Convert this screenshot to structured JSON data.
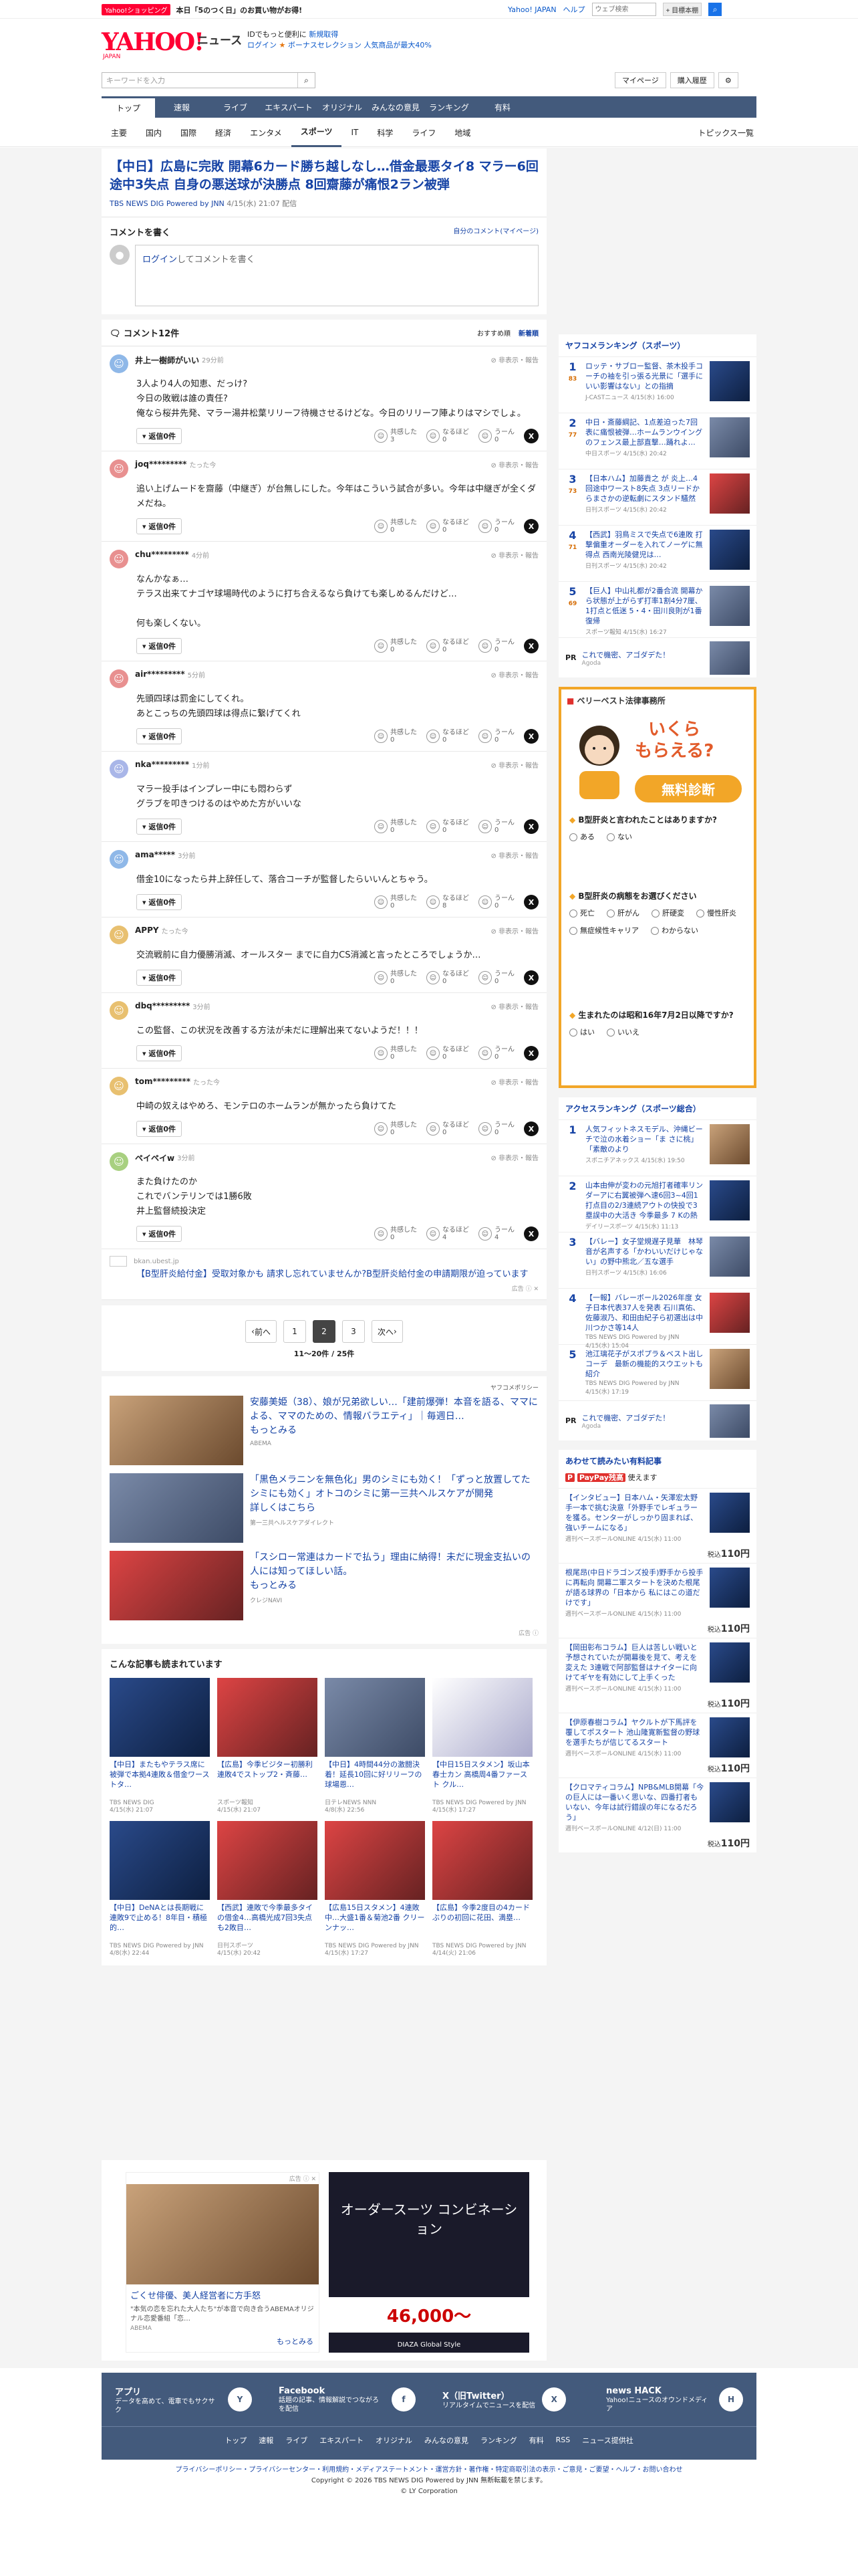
{
  "promo": {
    "tag": "Yahoo!ショッピング",
    "text": "本日「5のつく日」のお買い物がお得!",
    "links": [
      "Yahoo! JAPAN",
      "ヘルプ"
    ],
    "search_placeholder": "ウェブ検索",
    "search_button": "検索",
    "mark_button": "+ 目標本棚"
  },
  "header": {
    "logo": "YAHOO!",
    "logo_sub": "JAPAN",
    "title": "ニュース",
    "line1a": "IDでもっと便利に",
    "line1b": "新規取得",
    "line2a": "ログイン",
    "line2b": "ボーナスセレクション",
    "line2c": "人気商品が最大40%"
  },
  "search": {
    "placeholder": "キーワードを入力",
    "mypage": "マイページ",
    "history": "購入履歴"
  },
  "nav": {
    "tabs": [
      "トップ",
      "速報",
      "ライブ",
      "エキスパート",
      "オリジナル",
      "みんなの意見",
      "ランキング",
      "有料"
    ],
    "sub": [
      "主要",
      "国内",
      "国際",
      "経済",
      "エンタメ",
      "スポーツ",
      "IT",
      "科学",
      "ライフ",
      "地域"
    ],
    "topics": "トピックス一覧"
  },
  "article": {
    "title": "【中日】広島に完敗 開幕6カード勝ち越しなし…借金最悪タイ8 マラー6回途中3失点 自身の悪送球が決勝点 8回齋藤が痛恨2ラン被弾",
    "source": "TBS NEWS DIG Powered by JNN",
    "date": "4/15(水) 21:07 配信"
  },
  "comment_form": {
    "title": "コメントを書く",
    "mine": "自分のコメント(マイページ)",
    "login": "ログイン",
    "placeholder": "してコメントを書く"
  },
  "comments_header": {
    "title": "コメント12件",
    "sort1": "おすすめ順",
    "sort2": "新着順"
  },
  "labels": {
    "report": "非表示・報告",
    "reply": "返信0件",
    "r1": "共感した",
    "r2": "なるほど",
    "r3": "うーん"
  },
  "comments": [
    {
      "user": "井上一樹師がいい",
      "time": "29分前",
      "text": "3人より4人の知恵、だっけ?\n今日の敗戦は誰の責任?\n俺なら桜井先発、マラー湯井松葉リリーフ待機させるけどな。今日のリリーフ陣よりはマシでしょ。",
      "c1": "3",
      "c2": "0",
      "c3": "0",
      "color": "#8fb8e8"
    },
    {
      "user": "joq*********",
      "time": "たった今",
      "text": "追い上げムードを齋藤（中継ぎ）が台無しにした。今年はこういう試合が多い。今年は中継ぎが全くダメだね。",
      "c1": "0",
      "c2": "0",
      "c3": "0",
      "color": "#e89090"
    },
    {
      "user": "chu*********",
      "time": "4分前",
      "text": "なんかなぁ…\nテラス出来てナゴヤ球場時代のように打ち合えるなら負けても楽しめるんだけど…\n\n何も楽しくない。",
      "c1": "0",
      "c2": "0",
      "c3": "0",
      "color": "#e89090"
    },
    {
      "user": "air*********",
      "time": "5分前",
      "text": "先頭四球は罰金にしてくれ。\nあとこっちの先頭四球は得点に繋げてくれ",
      "c1": "0",
      "c2": "0",
      "c3": "0",
      "color": "#e89090"
    },
    {
      "user": "nka*********",
      "time": "1分前",
      "text": "マラー投手はインプレー中にも悶わらず\nグラブを叩きつけるのはやめた方がいいな",
      "c1": "0",
      "c2": "0",
      "c3": "0",
      "color": "#a9b6e8"
    },
    {
      "user": "ama*****",
      "time": "3分前",
      "text": "借金10になったら井上辞任して、落合コーチが監督したらいいんとちゃう。",
      "c1": "0",
      "c2": "8",
      "c3": "0",
      "color": "#8fb8e8"
    },
    {
      "user": "APPY",
      "time": "たった今",
      "text": "交流戦前に自力優勝消滅、オールスター までに自力CS消滅と言ったところでしょうか…",
      "c1": "0",
      "c2": "0",
      "c3": "0",
      "color": "#e8c070"
    },
    {
      "user": "dbq*********",
      "time": "3分前",
      "text": "この監督、この状況を改善する方法が未だに理解出来てないようだ！！！",
      "c1": "0",
      "c2": "0",
      "c3": "0",
      "color": "#e8c070"
    },
    {
      "user": "tom*********",
      "time": "たった今",
      "text": "中崎の奴えはやめろ、モンテロのホームランが無かったら負けてた",
      "c1": "0",
      "c2": "0",
      "c3": "0",
      "color": "#e8c070"
    },
    {
      "user": "ペイペイw",
      "time": "3分前",
      "text": "また負けたのか\nこれでバンテリンでは1勝6敗\n井上監督続投決定",
      "c1": "0",
      "c2": "4",
      "c3": "4",
      "color": "#a8d080"
    }
  ],
  "inline_ad": {
    "domain": "bkan.ubest.jp",
    "text": "【B型肝炎給付金】受取対象かも 請求し忘れていませんか?B型肝炎給付金の申請期限が迫っています",
    "label": "広告"
  },
  "pager": {
    "prev": "前へ",
    "pages": [
      "1",
      "2",
      "3"
    ],
    "next": "次へ",
    "info": "11〜20件 / 25件"
  },
  "ads": {
    "policy": "ヤフコメポリシー",
    "items": [
      {
        "text": "安藤美姫（38）、娘が兄弟欲しい…「建前爆弾！本音を語る、ママによる、ママのための、情報バラエティ」｜毎週日…",
        "more": "もっとみる",
        "sp": "ABEMA"
      },
      {
        "text": "「黒色メラニンを無色化」男のシミにも効く！「ずっと放置してたシミにも効く」オトコのシミに第一三共ヘルスケアが開発",
        "more": "詳しくはこちら",
        "sp": "第一三共ヘルスケアダイレクト"
      },
      {
        "text": "「スシロー常連はカードで払う」理由に納得！未だに現金支払いの人には知ってほしい話。",
        "more": "もっとみる",
        "sp": "クレジNAVI"
      }
    ],
    "label": "広告"
  },
  "readers": {
    "title": "こんな記事も読まれています",
    "items": [
      {
        "text": "【中日】またもやテラス席に被弾で本拠4連敗＆借金ワーストタ…",
        "src": "TBS NEWS DIG",
        "date": "4/15(水) 21:07"
      },
      {
        "text": "【広島】今季ビジター初勝利 連敗4でストップ2・斉藤…",
        "src": "スポーツ報知",
        "date": "4/15(水) 21:07"
      },
      {
        "text": "【中日】4時間44分の激闘決着！延長10回に好リリーフの球場恩…",
        "src": "日テレNEWS NNN",
        "date": "4/8(水) 22:56"
      },
      {
        "text": "【中日15日スタメン】坂山本春士カン 高橋周4番ファースト クル…",
        "src": "TBS NEWS DIG Powered by JNN",
        "date": "4/15(水) 17:27"
      },
      {
        "text": "【中日】DeNAとは長期戦に 連敗9で止める！8年目・積極的…",
        "src": "TBS NEWS DIG Powered by JNN",
        "date": "4/8(水) 22:44"
      },
      {
        "text": "【西武】連敗で今季最多タイの借金4…高橋光成7回3失点も2敗目…",
        "src": "日刊スポーツ",
        "date": "4/15(水) 20:42"
      },
      {
        "text": "【広島15日スタメン】4連敗中…大盛1番＆菊池2番 クリーンナッ…",
        "src": "TBS NEWS DIG Powered by JNN",
        "date": "4/15(水) 17:27"
      },
      {
        "text": "【広島】今季2度目の4カードぶりの初回に花田、満塁…",
        "src": "TBS NEWS DIG Powered by JNN",
        "date": "4/14(火) 21:06"
      }
    ]
  },
  "bottom_ad": {
    "label": "広告",
    "text": "ごくせ俳優、美人経営者に方手怒",
    "sub": "\"本気の恋を忘れた大人たち\"が本音で向き合うABEMAオリジナル恋愛番組「恋…",
    "src": "ABEMA",
    "more": "もっとみる",
    "a2_title": "オーダースーツ コンビネーション",
    "a2_price": "46,000〜",
    "a2_brand": "DIAZA Global Style"
  },
  "side_rank": {
    "title": "ヤフコメランキング（スポーツ）",
    "items": [
      {
        "n": "1",
        "c": "83",
        "text": "ロッテ・サブロー監督、茶木投手コーチの袖を引っ張る光景に「選手にいい影響はない」との指摘",
        "src": "J-CASTニュース 4/15(水) 16:00"
      },
      {
        "n": "2",
        "c": "77",
        "text": "中日・斎藤綱記、1点差迫った7回表に痛恨被弾…ホームランウイングのフェンス最上部直撃…踊れよ…",
        "src": "中日スポーツ 4/15(水) 20:42"
      },
      {
        "n": "3",
        "c": "73",
        "text": "【日本ハム】加藤貴之 が 炎上…4回途中ワースト8失点 3点リードからまさかの逆転劇にスタンド騒然",
        "src": "日刊スポーツ 4/15(水) 20:42"
      },
      {
        "n": "4",
        "c": "71",
        "text": "【西武】羽鳥ミスで失点で6連敗 打撃偏重オーダーを入れてノーゲに無得点 西南光陵健児は…",
        "src": "日刊スポーツ 4/15(水) 20:42"
      },
      {
        "n": "5",
        "c": "69",
        "text": "【巨人】中山礼都が2番合流 開幕から状態が上がらず打率1割4分7厘、1打点と低迷 5・4・田川良則が1番復帰",
        "src": "スポーツ報知 4/15(水) 16:27"
      }
    ],
    "pr_tag": "PR",
    "pr_text": "これで機密、アゴダデた！",
    "pr_src": "Agoda"
  },
  "bigad": {
    "brand_a": "ベリーベスト",
    "brand_b": "法律事務所",
    "head1": "いくら",
    "head2": "もらえる?",
    "free": "無料診断",
    "q1": "B型肝炎と言われたことはありますか?",
    "q1o": [
      "ある",
      "ない"
    ],
    "q2": "B型肝炎の病態をお選びください",
    "q2o": [
      "死亡",
      "肝がん",
      "肝硬変",
      "慢性肝炎",
      "無症候性キャリア",
      "わからない"
    ],
    "q3": "生まれたのは昭和16年7月2日以降ですか?",
    "q3o": [
      "はい",
      "いいえ"
    ]
  },
  "side_access": {
    "title": "アクセスランキング（スポーツ総合）",
    "items": [
      {
        "n": "1",
        "text": "人気フィットネスモデル、沖縄ビーチで泣の水着ショー「ま さに桃」「素敵のより",
        "src": "スポニチアネックス 4/15(水) 19:50"
      },
      {
        "n": "2",
        "text": "山本由伸が変わの元旭打者確率リンダーアに右翼被弾へ速6回3~4回1打点目の2/3連続アウトの快投で3塁誤中の大活き 今季最多 7 Kの熱投で速勝利ナシ",
        "src": "デイリースポーツ 4/15(水) 11:13"
      },
      {
        "n": "3",
        "text": "【バレー】女子堂規遅子見華　林琴音が名声する「かわいいだけじゃない」の野中熊北／五な選手",
        "src": "日刊スポーツ 4/15(水) 16:06"
      },
      {
        "n": "4",
        "text": "【一報】バレーボール2026年度 女子日本代表37人を発表 石川真佑、佐藤淑乃、和田由紀子ら初選出は中川つかさ等14人",
        "src": "TBS NEWS DIG Powered by JNN 4/15(水) 15:04"
      },
      {
        "n": "5",
        "text": "池江璃花子がスポプラ＆ベスト出しコーデ　最新の機能的スウエットも紹介",
        "src": "TBS NEWS DIG Powered by JNN 4/15(水) 17:19"
      }
    ],
    "pr_tag": "PR",
    "pr_text": "これで機密、アゴダデた！",
    "pr_src": "Agoda"
  },
  "paid": {
    "title": "あわせて読みたい有料記事",
    "brand": "PayPay残高",
    "brand_sub": "使えます",
    "price_label": "税込",
    "items": [
      {
        "text": "【インタビュー】日本ハム・矢澤宏太野手一本で挑む決意「外野手でレギュラーを獲る。センターがしっかり固まれば、強いチームになる」",
        "src": "週刊ベースボールONLINE 4/15(水) 11:00",
        "price": "110円"
      },
      {
        "text": "根尾昂(中日ドラゴンズ投手)野手から投手に再転向 開幕二軍スタートを決めた根尾が語る球界の「日本から 私にはこの道だけです」",
        "src": "週刊ベースボールONLINE 4/15(水) 11:00",
        "price": "110円"
      },
      {
        "text": "【岡田彰布コラム】巨人は苦しい戦いと予想されていたが開幕後を見て、考えを変えた 3連戦で阿部監督はナイターに向けてギヤを有効にして上手くった",
        "src": "週刊ベースボールONLINE 4/15(水) 11:00",
        "price": "110円"
      },
      {
        "text": "【伊原春樹コラム】ヤクルトが下馬評を覆してポスタート 池山隆寛新監督の野球を選手たちが信じてるスタート",
        "src": "週刊ベースボールONLINE 4/15(水) 11:00",
        "price": "110円"
      },
      {
        "text": "【クロマティコラム】NPB&MLB開幕「今の巨人には一番いく思いな、四番打者もいない、今年は試行錯誤の年になるだろう」",
        "src": "週刊ベースボールONLINE 4/12(日) 11:00",
        "price": "110円"
      }
    ]
  },
  "footer": {
    "items": [
      {
        "t": "アプリ",
        "d": "データを高めて、電車でもサクサク",
        "ic": "Y"
      },
      {
        "t": "Facebook",
        "d": "話題の記事、情報解説でつながろを配信",
        "ic": "f"
      },
      {
        "t": "X（旧Twitter）",
        "d": "リアルタイムでニュースを配信",
        "ic": "X"
      },
      {
        "t": "news HACK",
        "d": "Yahoo!ニュースのオウンドメディア",
        "ic": "H"
      }
    ],
    "links": [
      "トップ",
      "速報",
      "ライブ",
      "エキスパート",
      "オリジナル",
      "みんなの意見",
      "ランキング",
      "有料",
      "RSS",
      "ニュース提供社"
    ],
    "legal1": "プライバシーポリシー・プライバシーセンター・利用規約・メディアステートメント・運営方針・著作権・特定商取引法の表示・ご意見・ご要望・ヘルプ・お問い合わせ",
    "copyright": "Copyright © 2026 TBS NEWS DIG Powered by JNN 無断転載を禁じます。",
    "corp": "© LY Corporation"
  },
  "colors": {
    "nav": "#435a7c",
    "link": "#1643a5",
    "brand": "#ff0033"
  }
}
